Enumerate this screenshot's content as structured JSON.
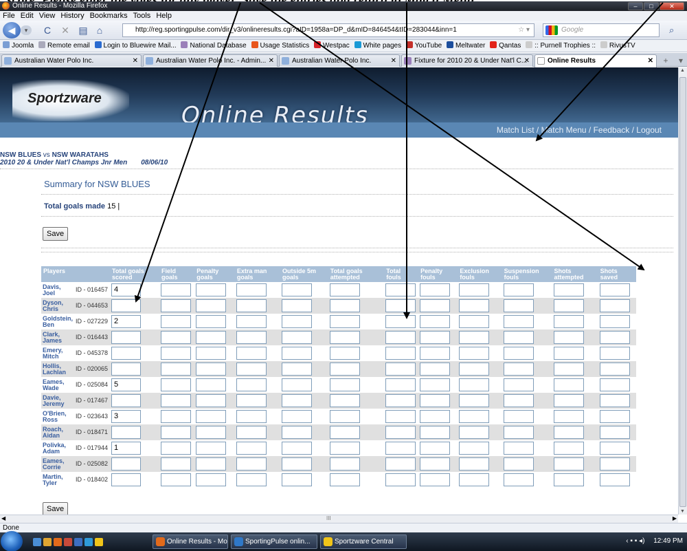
{
  "caption": "score. Please enter the votes for any player. Save the entries and return to Match Menu",
  "browser": {
    "window_title": "Online Results - Mozilla Firefox",
    "menu": [
      "File",
      "Edit",
      "View",
      "History",
      "Bookmarks",
      "Tools",
      "Help"
    ],
    "url": "http://reg.sportingpulse.com/dir_v3/onlineresults.cgi?aID=1958a=DP_d&mID=846454&tID=283044&inn=1",
    "search_placeholder": "Google",
    "bookmarks": [
      "Joomla",
      "Remote email",
      "Login to Bluewire Mail...",
      "National Database",
      "Usage Statistics",
      "Westpac",
      "White pages",
      "YouTube",
      "Meltwater",
      "Qantas",
      ":: Purnell Trophies ::",
      "RivusTV"
    ],
    "tabs": [
      {
        "label": "Australian Water Polo Inc."
      },
      {
        "label": "Australian Water Polo Inc. - Admin..."
      },
      {
        "label": "Australian Water Polo Inc."
      },
      {
        "label": "Fixture for 2010 20 & Under Nat'l C..."
      },
      {
        "label": "Online Results"
      }
    ],
    "status": "Done",
    "scroll_mid": "III"
  },
  "page": {
    "logo": "Sportzware",
    "title": "Online Results",
    "nav": "Match List / Match Menu / Feedback / Logout",
    "home_team": "NSW BLUES",
    "vs": "vs",
    "away_team": "NSW WARATAHS",
    "competition": "2010 20 & Under Nat'l Champs Jnr Men",
    "date": "08/06/10",
    "summary_title": "Summary for NSW BLUES",
    "total_goals_label": "Total goals made",
    "total_goals_value": "15 |",
    "save_label": "Save"
  },
  "table": {
    "headers": [
      "Players",
      "Total goals scored",
      "Field goals",
      "Penalty goals",
      "Extra man goals",
      "Outside 5m goals",
      "Total goals attempted",
      "Total fouls",
      "Penalty fouls",
      "Exclusion fouls",
      "Suspension fouls",
      "Shots attempted",
      "Shots saved"
    ],
    "rows": [
      {
        "name": "Davis, Joel",
        "id": "ID - 016457",
        "goals": "4"
      },
      {
        "name": "Dyson, Chris",
        "id": "ID - 044653",
        "goals": ""
      },
      {
        "name": "Goldstein, Ben",
        "id": "ID - 027229",
        "goals": "2"
      },
      {
        "name": "Clark, James",
        "id": "ID - 016443",
        "goals": ""
      },
      {
        "name": "Emery, Mitch",
        "id": "ID - 045378",
        "goals": ""
      },
      {
        "name": "Hollis, Lachlan",
        "id": "ID - 020065",
        "goals": ""
      },
      {
        "name": "Eames, Wade",
        "id": "ID - 025084",
        "goals": "5"
      },
      {
        "name": "Davie, Jeremy",
        "id": "ID - 017467",
        "goals": ""
      },
      {
        "name": "O'Brien, Ross",
        "id": "ID - 023643",
        "goals": "3"
      },
      {
        "name": "Roach, Aidan",
        "id": "ID - 018471",
        "goals": ""
      },
      {
        "name": "Polivka, Adam",
        "id": "ID - 017944",
        "goals": "1"
      },
      {
        "name": "Eames, Corrie",
        "id": "ID - 025082",
        "goals": ""
      },
      {
        "name": "Martin, Tyler",
        "id": "ID - 018402",
        "goals": ""
      }
    ]
  },
  "taskbar": {
    "buttons": [
      "Online Results - Mo...",
      "SportingPulse onlin...",
      "Sportzware Central"
    ],
    "clock": "12:49 PM"
  }
}
